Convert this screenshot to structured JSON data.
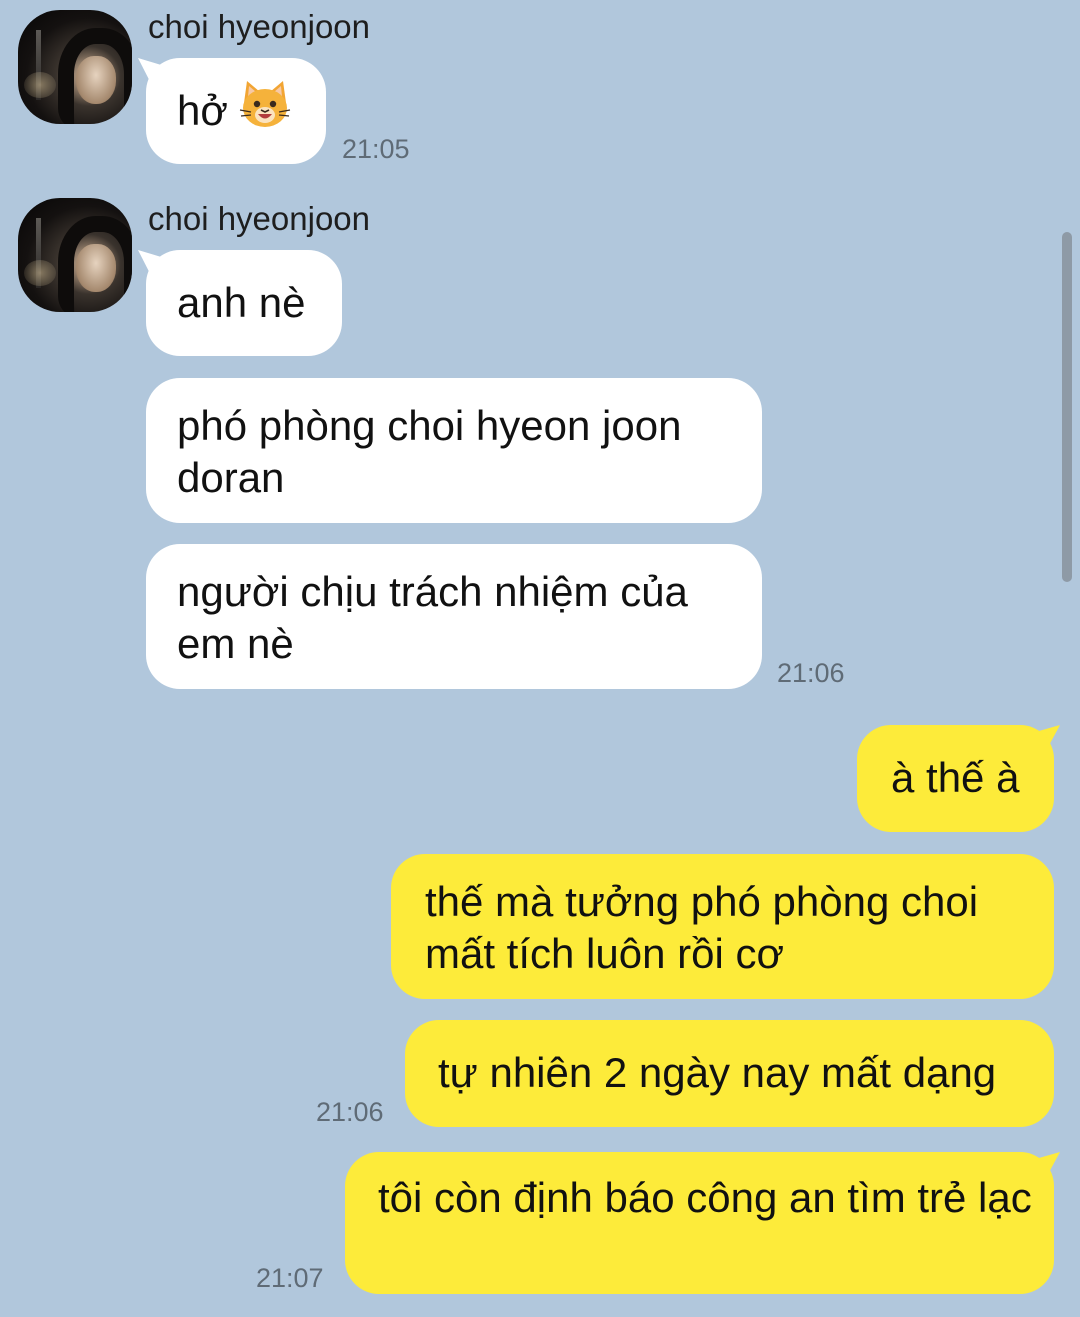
{
  "contact": {
    "name": "choi hyeonjoon"
  },
  "messages": [
    {
      "sender": "choi hyeonjoon",
      "text": "hở",
      "emoji": "grinning-cat-emoji",
      "time": "21:05"
    },
    {
      "sender": "choi hyeonjoon",
      "texts": [
        "anh nè",
        "phó phòng choi hyeon joon doran",
        "người chịu trách nhiệm của em nè"
      ],
      "time": "21:06"
    },
    {
      "sender": "me",
      "texts": [
        "à thế à",
        "thế mà tưởng phó phòng choi mất tích luôn rồi cơ",
        "tự nhiên 2 ngày nay mất dạng"
      ],
      "time": "21:06"
    },
    {
      "sender": "me",
      "texts": [
        "tôi còn định báo công an tìm trẻ lạc"
      ],
      "time": "21:07"
    }
  ],
  "colors": {
    "background": "#b1c7dc",
    "incoming_bubble": "#ffffff",
    "outgoing_bubble": "#fdeb3a",
    "timestamp": "#5f6b76"
  }
}
